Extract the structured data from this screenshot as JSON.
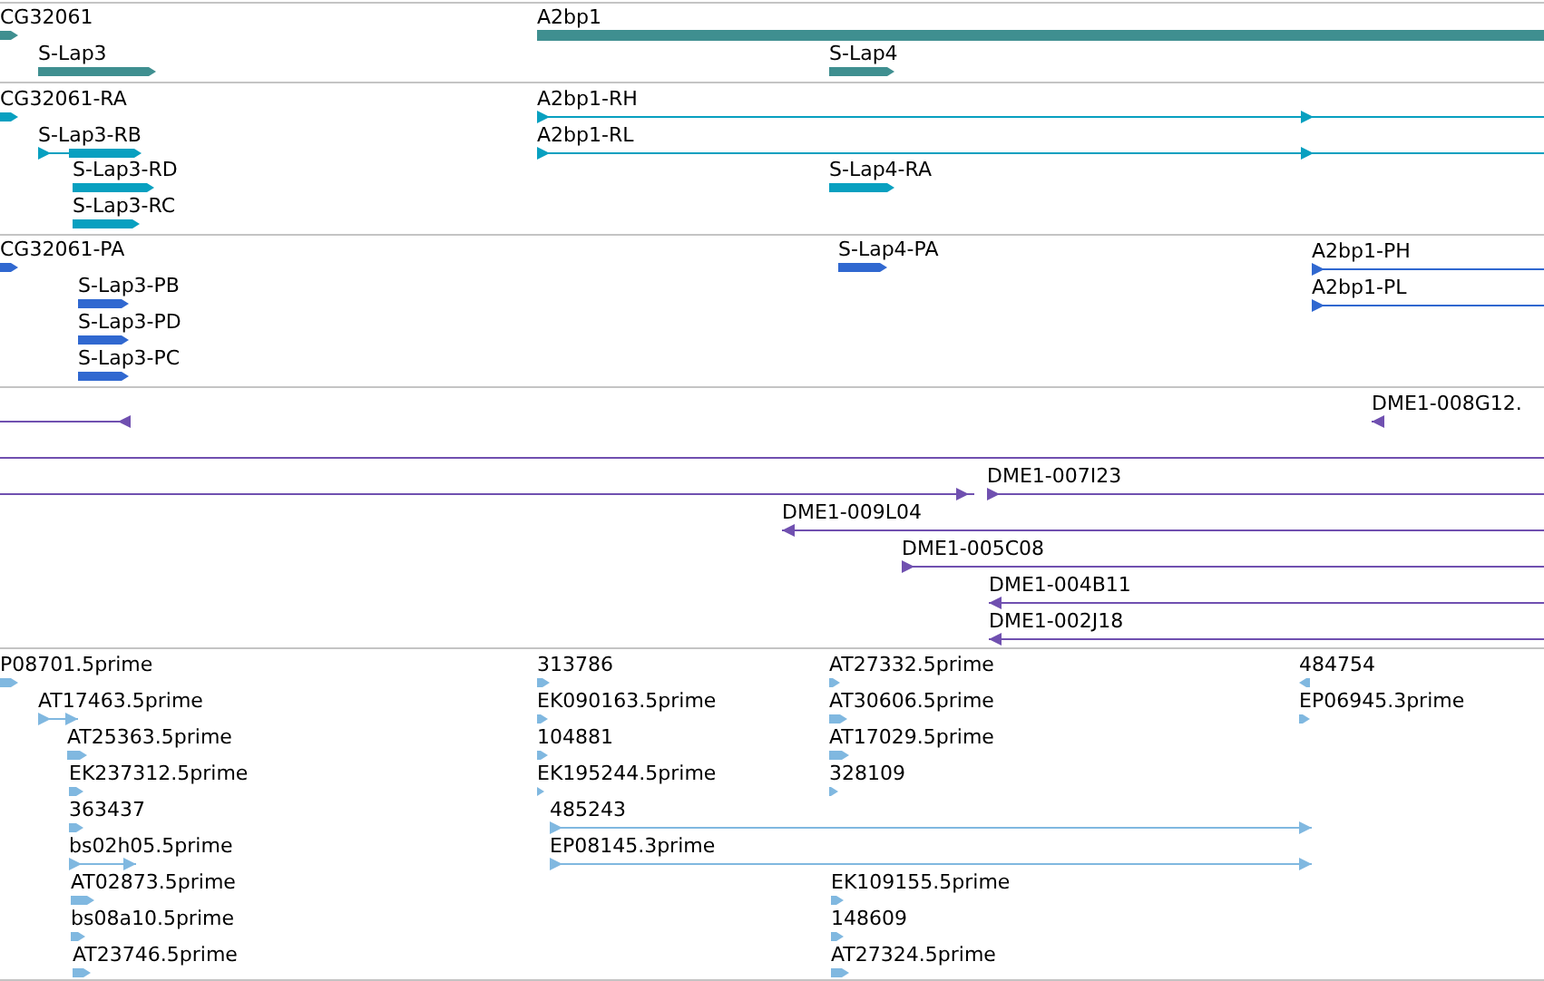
{
  "tracks": [
    {
      "color": "#3f8f90",
      "features": [
        {
          "label": "CG32061",
          "kind": "block",
          "reverse": false
        },
        {
          "label": "A2bp1",
          "kind": "block",
          "reverse": false
        },
        {
          "label": "S-Lap3",
          "kind": "block",
          "reverse": false
        },
        {
          "label": "S-Lap4",
          "kind": "block",
          "reverse": false
        }
      ]
    },
    {
      "color": "#08a0c0",
      "features": [
        {
          "label": "CG32061-RA",
          "kind": "block",
          "reverse": false
        },
        {
          "label": "A2bp1-RH",
          "kind": "line",
          "reverse": false
        },
        {
          "label": "S-Lap3-RB",
          "kind": "mixed",
          "reverse": false
        },
        {
          "label": "A2bp1-RL",
          "kind": "line",
          "reverse": false
        },
        {
          "label": "S-Lap3-RD",
          "kind": "block",
          "reverse": false
        },
        {
          "label": "S-Lap4-RA",
          "kind": "block",
          "reverse": false
        },
        {
          "label": "S-Lap3-RC",
          "kind": "block",
          "reverse": false
        }
      ]
    },
    {
      "color": "#3068d0",
      "features": [
        {
          "label": "CG32061-PA",
          "kind": "block",
          "reverse": false
        },
        {
          "label": "S-Lap4-PA",
          "kind": "block",
          "reverse": false
        },
        {
          "label": "A2bp1-PH",
          "kind": "line",
          "reverse": false
        },
        {
          "label": "S-Lap3-PB",
          "kind": "block",
          "reverse": false
        },
        {
          "label": "A2bp1-PL",
          "kind": "line",
          "reverse": false
        },
        {
          "label": "S-Lap3-PD",
          "kind": "block",
          "reverse": false
        },
        {
          "label": "S-Lap3-PC",
          "kind": "block",
          "reverse": false
        }
      ]
    },
    {
      "color": "#7050b0",
      "features": [
        {
          "kind": "line",
          "reverse": true
        },
        {
          "label": "DME1-008G12.",
          "kind": "line",
          "reverse": true
        },
        {
          "kind": "line"
        },
        {
          "kind": "line",
          "reverse": false
        },
        {
          "label": "DME1-007I23",
          "kind": "line",
          "reverse": false
        },
        {
          "label": "DME1-009L04",
          "kind": "line",
          "reverse": true
        },
        {
          "label": "DME1-005C08",
          "kind": "line",
          "reverse": false
        },
        {
          "label": "DME1-004B11",
          "kind": "line",
          "reverse": true
        },
        {
          "label": "DME1-002J18",
          "kind": "line",
          "reverse": true
        }
      ]
    },
    {
      "color": "#80b8e0",
      "features": [
        {
          "label": "P08701.5prime",
          "kind": "block",
          "reverse": false
        },
        {
          "label": "313786",
          "kind": "block",
          "reverse": false
        },
        {
          "label": "AT27332.5prime",
          "kind": "block",
          "reverse": false
        },
        {
          "label": "484754",
          "kind": "block",
          "reverse": true
        },
        {
          "label": "AT17463.5prime",
          "kind": "line",
          "reverse": false
        },
        {
          "label": "EK090163.5prime",
          "kind": "block",
          "reverse": false
        },
        {
          "label": "AT30606.5prime",
          "kind": "block",
          "reverse": false
        },
        {
          "label": "EP06945.3prime",
          "kind": "block",
          "reverse": false
        },
        {
          "label": "AT25363.5prime",
          "kind": "block",
          "reverse": false
        },
        {
          "label": "104881",
          "kind": "block",
          "reverse": false
        },
        {
          "label": "AT17029.5prime",
          "kind": "block",
          "reverse": false
        },
        {
          "label": "EK237312.5prime",
          "kind": "block",
          "reverse": false
        },
        {
          "label": "EK195244.5prime",
          "kind": "block",
          "reverse": false
        },
        {
          "label": "328109",
          "kind": "block",
          "reverse": false
        },
        {
          "label": "363437",
          "kind": "block",
          "reverse": false
        },
        {
          "label": "485243",
          "kind": "line",
          "reverse": false
        },
        {
          "label": "bs02h05.5prime",
          "kind": "line",
          "reverse": false
        },
        {
          "label": "EP08145.3prime",
          "kind": "line",
          "reverse": false
        },
        {
          "label": "AT02873.5prime",
          "kind": "block",
          "reverse": false
        },
        {
          "label": "EK109155.5prime",
          "kind": "block",
          "reverse": false
        },
        {
          "label": "bs08a10.5prime",
          "kind": "block",
          "reverse": false
        },
        {
          "label": "148609",
          "kind": "block",
          "reverse": false
        },
        {
          "label": "AT23746.5prime",
          "kind": "block",
          "reverse": false
        },
        {
          "label": "AT27324.5prime",
          "kind": "block",
          "reverse": false
        }
      ]
    }
  ]
}
